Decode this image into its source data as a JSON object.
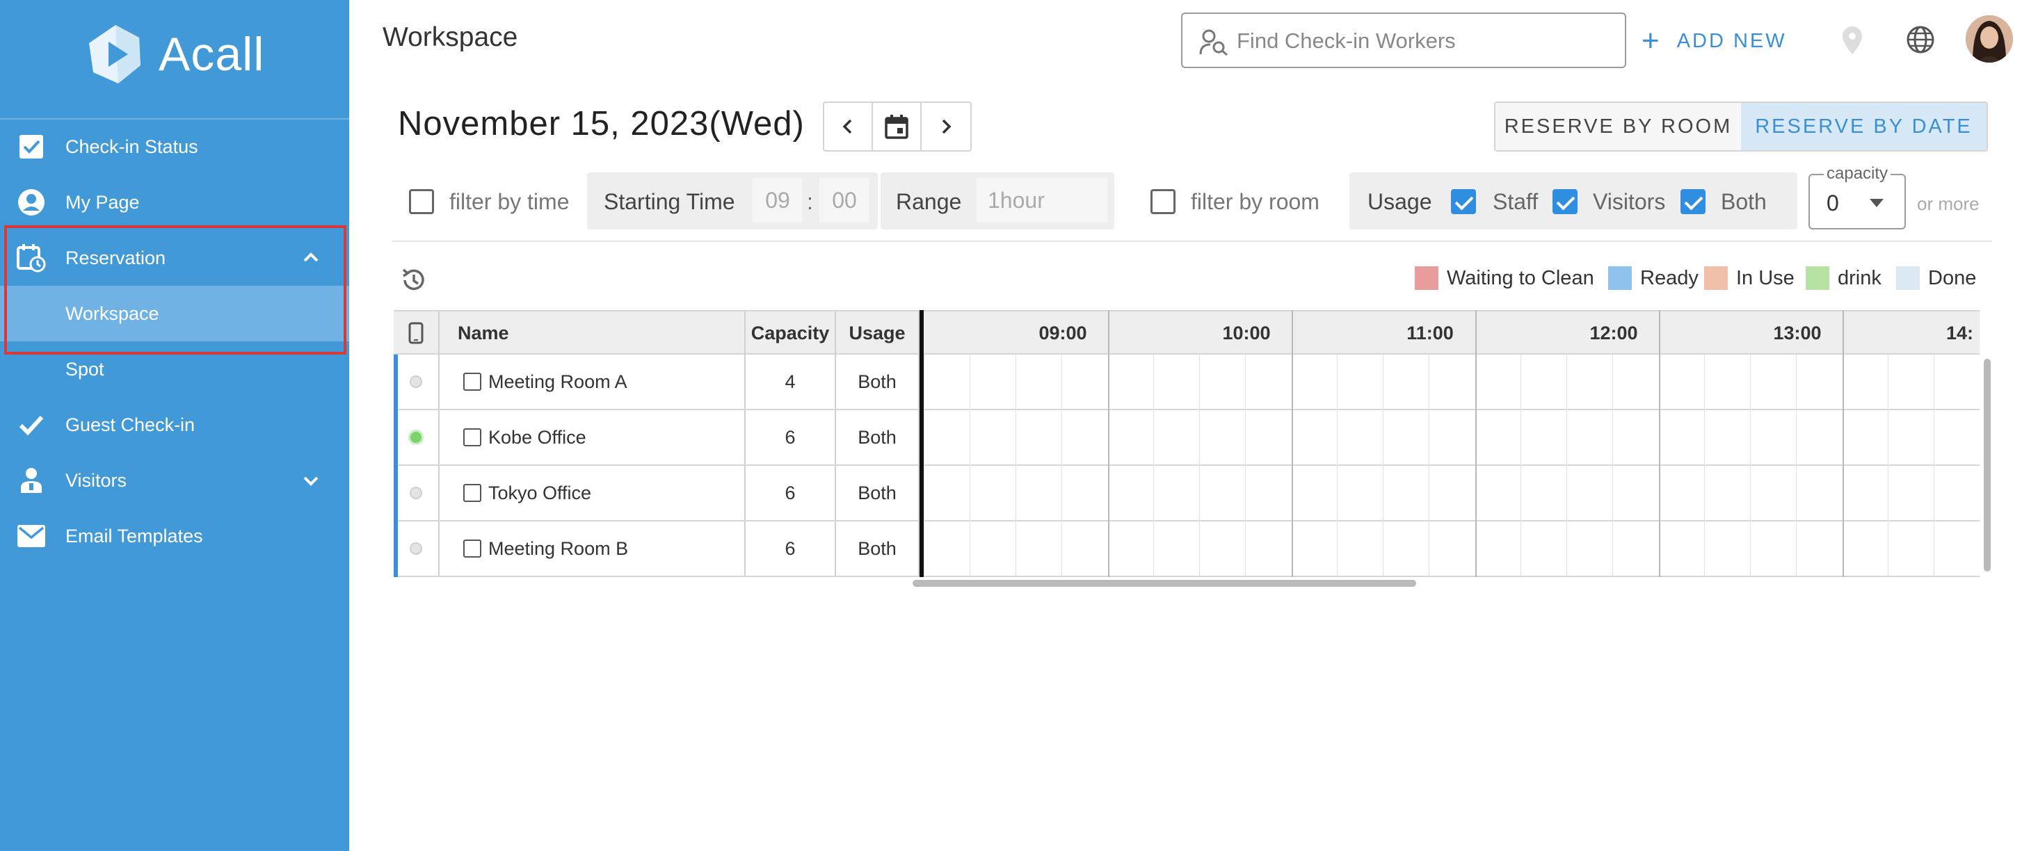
{
  "sidebar": {
    "logo_text": "Acall",
    "items": [
      {
        "label": "Check-in Status",
        "icon": "check-square-icon"
      },
      {
        "label": "My Page",
        "icon": "user-circle-icon"
      },
      {
        "label": "Reservation",
        "icon": "calendar-clock-icon",
        "expanded": true
      },
      {
        "label": "Workspace",
        "active": true
      },
      {
        "label": "Spot"
      },
      {
        "label": "Guest Check-in",
        "icon": "checkmark-icon"
      },
      {
        "label": "Visitors",
        "icon": "visitors-icon",
        "expanded": false
      },
      {
        "label": "Email Templates",
        "icon": "envelope-icon"
      }
    ],
    "accent_color": "#4299d8",
    "highlight_color": "#d83a3a"
  },
  "header": {
    "title": "Workspace",
    "search_placeholder": "Find Check-in Workers",
    "add_new_label": "ADD NEW"
  },
  "toolbar": {
    "date": "November 15, 2023(Wed)",
    "reserve_by_room": "RESERVE BY ROOM",
    "reserve_by_date": "RESERVE BY DATE"
  },
  "filters": {
    "filter_by_time": "filter by time",
    "starting_time_label": "Starting Time",
    "start_hour": "09",
    "time_sep": ":",
    "start_minute": "00",
    "range_label": "Range",
    "range_value": "1hour",
    "filter_by_room": "filter by room",
    "usage_label": "Usage",
    "usage_options": [
      {
        "label": "Staff",
        "checked": true
      },
      {
        "label": "Visitors",
        "checked": true
      },
      {
        "label": "Both",
        "checked": true
      }
    ],
    "capacity_label": "capacity",
    "capacity_value": "0",
    "or_more": "or more"
  },
  "legend": [
    {
      "label": "Waiting to Clean",
      "color": "#e89c9c"
    },
    {
      "label": "Ready",
      "color": "#8fc3ee"
    },
    {
      "label": "In Use",
      "color": "#f0c0a8"
    },
    {
      "label": "drink",
      "color": "#b6e2a4"
    },
    {
      "label": "Done",
      "color": "#dce9f5"
    }
  ],
  "table": {
    "columns": {
      "name": "Name",
      "capacity": "Capacity",
      "usage": "Usage"
    },
    "hours": [
      "09:00",
      "10:00",
      "11:00",
      "12:00",
      "13:00",
      "14:"
    ],
    "rows": [
      {
        "name": "Meeting Room A",
        "capacity": "4",
        "usage": "Both",
        "online": false
      },
      {
        "name": "Kobe Office",
        "capacity": "6",
        "usage": "Both",
        "online": true
      },
      {
        "name": "Tokyo Office",
        "capacity": "6",
        "usage": "Both",
        "online": false
      },
      {
        "name": "Meeting Room B",
        "capacity": "6",
        "usage": "Both",
        "online": false
      }
    ]
  }
}
